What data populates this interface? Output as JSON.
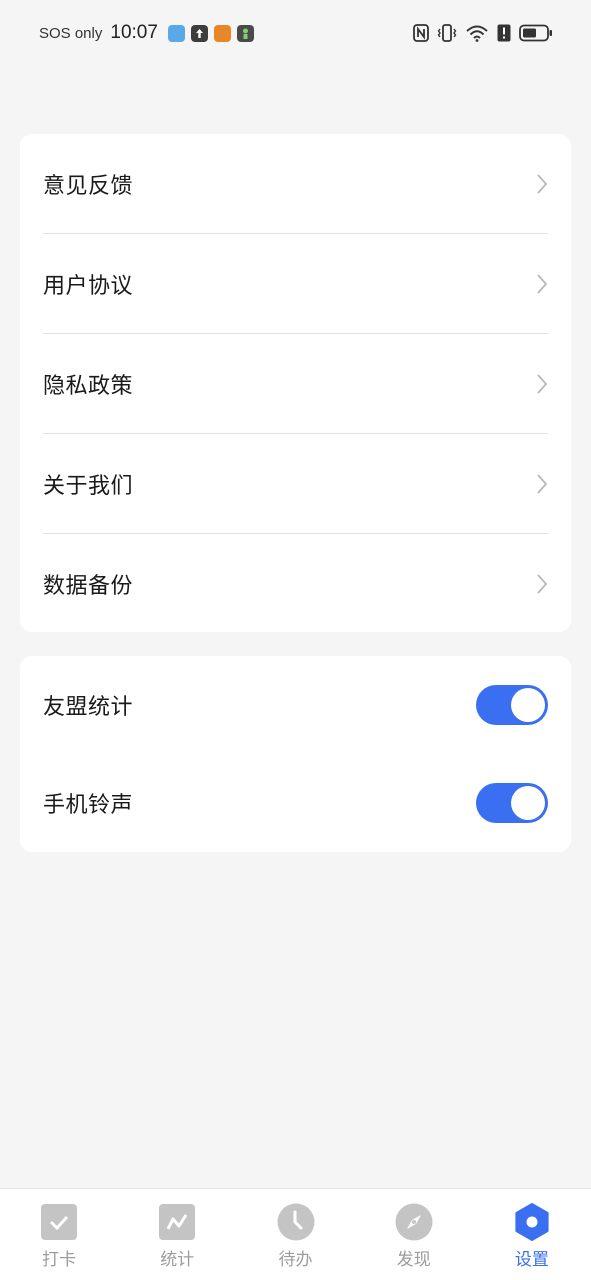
{
  "status_bar": {
    "carrier": "SOS only",
    "time": "10:07",
    "icons": [
      "weather-app-icon",
      "upload-app-icon",
      "novel-app-icon",
      "game-app-icon",
      "nfc-icon",
      "vibrate-icon",
      "wifi-icon",
      "alert-icon",
      "battery-icon"
    ]
  },
  "settings": {
    "links": [
      {
        "label": "意见反馈"
      },
      {
        "label": "用户协议"
      },
      {
        "label": "隐私政策"
      },
      {
        "label": "关于我们"
      },
      {
        "label": "数据备份"
      }
    ],
    "toggles": [
      {
        "label": "友盟统计",
        "on": true
      },
      {
        "label": "手机铃声",
        "on": true
      }
    ]
  },
  "tabbar": {
    "tabs": [
      {
        "label": "打卡",
        "icon": "check-icon"
      },
      {
        "label": "统计",
        "icon": "chart-icon"
      },
      {
        "label": "待办",
        "icon": "clock-icon"
      },
      {
        "label": "发现",
        "icon": "compass-icon"
      },
      {
        "label": "设置",
        "icon": "settings-icon",
        "active": true
      }
    ]
  },
  "colors": {
    "accent": "#3a6ff2",
    "background": "#f5f5f5",
    "card": "#ffffff",
    "inactive_tab": "#9c9c9c"
  }
}
